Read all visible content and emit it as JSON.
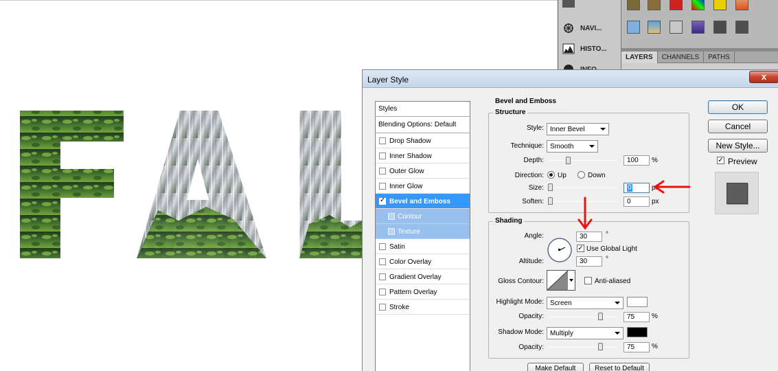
{
  "canvas": {
    "text": "FAL"
  },
  "dock": {
    "items": [
      {
        "label": "NAVI..."
      },
      {
        "label": "HISTO..."
      },
      {
        "label": "INFO"
      }
    ]
  },
  "layers_panel": {
    "tabs": [
      "LAYERS",
      "CHANNELS",
      "PATHS"
    ]
  },
  "dialog": {
    "title": "Layer Style",
    "close_label": "x",
    "styles_header": "Styles",
    "blending_options": "Blending Options: Default",
    "styles": [
      {
        "label": "Drop Shadow",
        "checked": false
      },
      {
        "label": "Inner Shadow",
        "checked": false
      },
      {
        "label": "Outer Glow",
        "checked": false
      },
      {
        "label": "Inner Glow",
        "checked": false
      },
      {
        "label": "Bevel and Emboss",
        "checked": true
      },
      {
        "label": "Contour",
        "checked": false
      },
      {
        "label": "Texture",
        "checked": false
      },
      {
        "label": "Satin",
        "checked": false
      },
      {
        "label": "Color Overlay",
        "checked": false
      },
      {
        "label": "Gradient Overlay",
        "checked": false
      },
      {
        "label": "Pattern Overlay",
        "checked": false
      },
      {
        "label": "Stroke",
        "checked": false
      }
    ],
    "section_title": "Bevel and Emboss",
    "structure": {
      "legend": "Structure",
      "style_label": "Style:",
      "style_value": "Inner Bevel",
      "technique_label": "Technique:",
      "technique_value": "Smooth",
      "depth_label": "Depth:",
      "depth_value": "100",
      "depth_unit": "%",
      "direction_label": "Direction:",
      "direction_up": "Up",
      "direction_down": "Down",
      "size_label": "Size:",
      "size_value": "0",
      "size_unit": "px",
      "soften_label": "Soften:",
      "soften_value": "0",
      "soften_unit": "px"
    },
    "shading": {
      "legend": "Shading",
      "angle_label": "Angle:",
      "angle_value": "30",
      "angle_unit": "°",
      "global_light_label": "Use Global Light",
      "altitude_label": "Altitude:",
      "altitude_value": "30",
      "altitude_unit": "°",
      "gloss_label": "Gloss Contour:",
      "anti_aliased_label": "Anti-aliased",
      "highlight_label": "Highlight Mode:",
      "highlight_value": "Screen",
      "highlight_color": "#ffffff",
      "opacity_label": "Opacity:",
      "highlight_opacity": "75",
      "shadow_label": "Shadow Mode:",
      "shadow_value": "Multiply",
      "shadow_color": "#000000",
      "shadow_opacity": "75",
      "percent": "%"
    },
    "buttons": {
      "ok": "OK",
      "cancel": "Cancel",
      "new_style": "New Style...",
      "preview": "Preview",
      "make_default": "Make Default",
      "reset_default": "Reset to Default"
    }
  },
  "colors": {
    "selection": "#3399ff",
    "annotation_arrow": "#ee1111"
  }
}
